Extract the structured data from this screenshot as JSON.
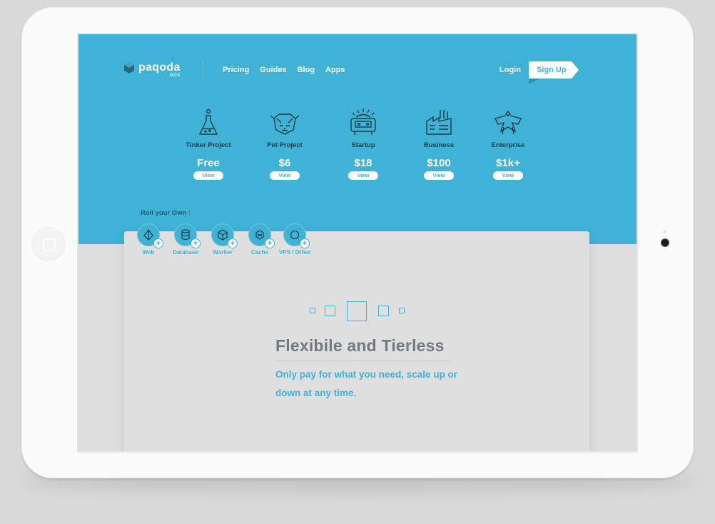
{
  "nav": {
    "logo_text": "paqoda",
    "logo_sub": "BOX",
    "links": [
      "Pricing",
      "Guides",
      "Blog",
      "Apps"
    ],
    "login": "Login",
    "signup": "Sign Up"
  },
  "plans": [
    {
      "name": "Tinker Project",
      "price": "Free",
      "view": "View",
      "icon": "flask-icon"
    },
    {
      "name": "Pet Project",
      "price": "$6",
      "view": "View",
      "icon": "cat-icon"
    },
    {
      "name": "Startup",
      "price": "$18",
      "view": "View",
      "icon": "robot-icon"
    },
    {
      "name": "Business",
      "price": "$100",
      "view": "View",
      "icon": "factory-icon"
    },
    {
      "name": "Enterprise",
      "price": "$1k+",
      "view": "View",
      "icon": "eagle-icon"
    }
  ],
  "roll": {
    "label": "Roll your Own :",
    "items": [
      {
        "label": "Web",
        "icon": "diamond-icon"
      },
      {
        "label": "Database",
        "icon": "database-icon"
      },
      {
        "label": "Worker",
        "icon": "cube-icon"
      },
      {
        "label": "Cache",
        "icon": "cache-icon"
      },
      {
        "label": "VPS / Other",
        "icon": "circle-icon"
      }
    ],
    "plus": "+"
  },
  "feature": {
    "headline": "Flexibile and Tierless",
    "subtext": "Only pay for what you need, scale up or down at any time."
  },
  "colors": {
    "accent": "#3fb2d5",
    "dark": "#1f3a47",
    "headline": "#6f7b82",
    "background": "#dedede"
  }
}
